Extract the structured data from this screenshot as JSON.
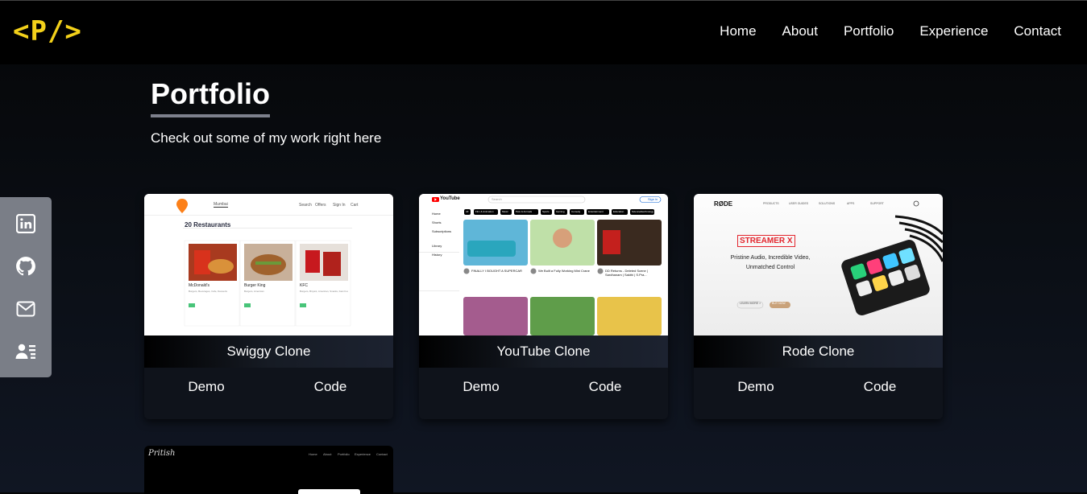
{
  "brand": {
    "logo_text": "<P/>",
    "logo_color": "#f3d11a"
  },
  "nav": {
    "items": [
      "Home",
      "About",
      "Portfolio",
      "Experience",
      "Contact"
    ]
  },
  "page": {
    "title": "Portfolio",
    "subtitle": "Check out some of my work right here"
  },
  "social": [
    {
      "name": "linkedin-icon"
    },
    {
      "name": "github-icon"
    },
    {
      "name": "mail-icon"
    },
    {
      "name": "resume-icon"
    }
  ],
  "projects": [
    {
      "name": "Swiggy Clone",
      "demo_label": "Demo",
      "code_label": "Code",
      "preview": {
        "header_items": [
          "Search",
          "Offers",
          "Sign In",
          "Cart"
        ],
        "heading": "20 Restaurants",
        "restaurants": [
          {
            "name": "McDonald's",
            "cuisine": "Burgers, Beverages, Cafe, Desserts"
          },
          {
            "name": "Burger King",
            "cuisine": "Burgers, American"
          },
          {
            "name": "KFC",
            "cuisine": "Burgers, Biryani, American, Snacks, Fast Food"
          }
        ]
      }
    },
    {
      "name": "YouTube Clone",
      "demo_label": "Demo",
      "code_label": "Code",
      "preview": {
        "logo": "YouTube",
        "search_placeholder": "Search",
        "sign_in": "Sign in",
        "chips": [
          "All",
          "Film & Animation",
          "Music",
          "Pets & Animals",
          "Sports",
          "Gaming",
          "Comedy",
          "Entertainment",
          "Education",
          "Science&technology"
        ],
        "sidebar": [
          "Home",
          "Shorts",
          "Subscriptions",
          "Library",
          "History"
        ],
        "videos": [
          "FINALLY I BOUGHT A SUPERCAR",
          "We Built a Fully Working Mini Crane",
          "DD Returns - Deleted Scene | Sardhanam | Sakthi | S.Pra..."
        ]
      }
    },
    {
      "name": "Rode Clone",
      "demo_label": "Demo",
      "code_label": "Code",
      "preview": {
        "logo": "RØDE",
        "menu": [
          "PRODUCTS",
          "USER GUIDES",
          "SOLUTIONS",
          "APPS",
          "SUPPORT"
        ],
        "product": "STREAMER X",
        "headline": "Pristine Audio, Incredible Video, Unmatched Control",
        "primary_cta": "LEARN MORE >",
        "secondary_cta": "BUY NOW"
      }
    }
  ],
  "partial_card": {
    "brand": "Pritish",
    "menu": [
      "Home",
      "About",
      "Portfolio",
      "Experience",
      "Contact"
    ]
  }
}
